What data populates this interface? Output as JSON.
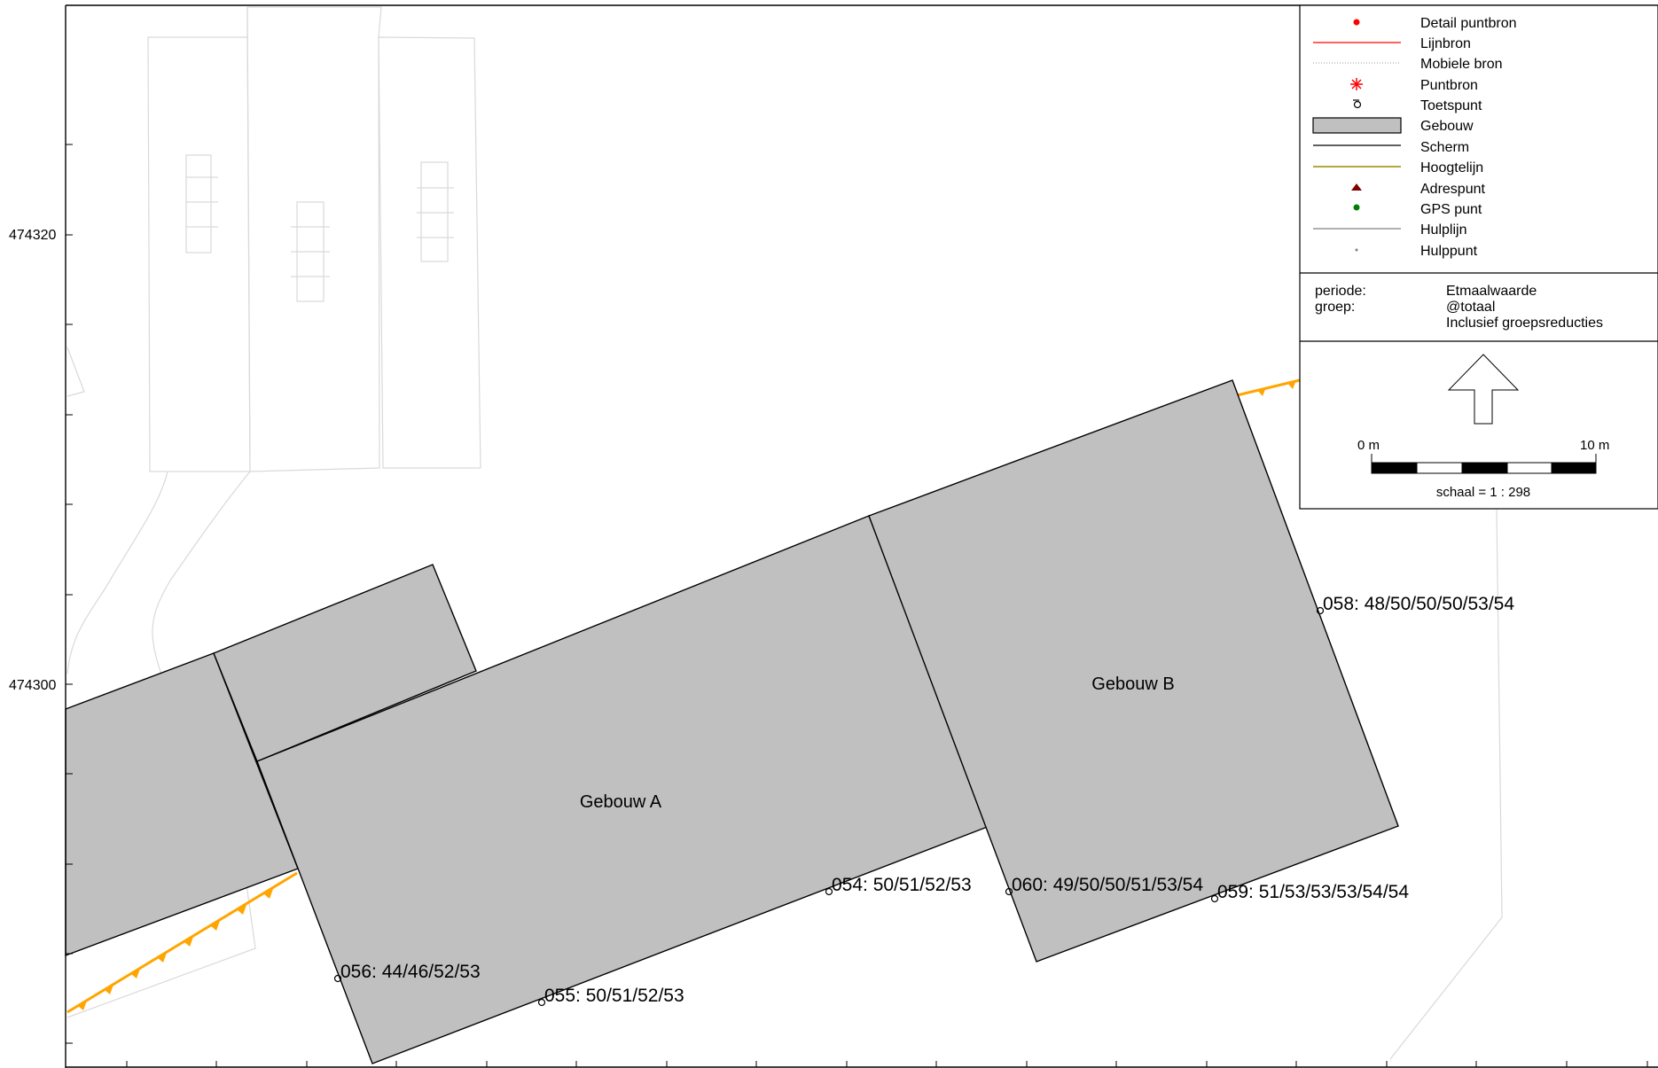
{
  "axis": {
    "y_labels": [
      "474320",
      "474300"
    ]
  },
  "buildings": [
    {
      "id": "gebouw-a",
      "label": "Gebouw A"
    },
    {
      "id": "gebouw-b",
      "label": "Gebouw B"
    }
  ],
  "test_points": [
    {
      "label": "056: 44/46/52/53"
    },
    {
      "label": "055: 50/51/52/53"
    },
    {
      "label": "054: 50/51/52/53"
    },
    {
      "label": "060: 49/50/50/51/53/54"
    },
    {
      "label": "059: 51/53/53/53/54/54"
    },
    {
      "label": "058: 48/50/50/50/53/54"
    }
  ],
  "legend": {
    "items": [
      {
        "label": "Detail puntbron",
        "symbol": "dot-red"
      },
      {
        "label": "Lijnbron",
        "symbol": "line-red"
      },
      {
        "label": "Mobiele bron",
        "symbol": "line-dotted"
      },
      {
        "label": "Puntbron",
        "symbol": "asterisk-red"
      },
      {
        "label": "Toetspunt",
        "symbol": "toetspunt"
      },
      {
        "label": "Gebouw",
        "symbol": "rect-gray"
      },
      {
        "label": "Scherm",
        "symbol": "line-black"
      },
      {
        "label": "Hoogtelijn",
        "symbol": "line-olive"
      },
      {
        "label": "Adrespunt",
        "symbol": "triangle-darkred"
      },
      {
        "label": "GPS punt",
        "symbol": "dot-green"
      },
      {
        "label": "Hulplijn",
        "symbol": "line-gray"
      },
      {
        "label": "Hulppunt",
        "symbol": "dot-gray"
      }
    ],
    "info": {
      "periode_key": "periode:",
      "periode_value": "Etmaalwaarde",
      "groep_key": "groep:",
      "groep_value": "@totaal",
      "groep_extra": "Inclusief groepsreducties"
    },
    "scale": {
      "start": "0 m",
      "end": "10 m",
      "text": "schaal = 1 : 298"
    }
  },
  "colors": {
    "building_fill": "#c0c0c0",
    "screen_line": "#ffa500",
    "background_lines": "#d9d9d9",
    "red": "#ff0000",
    "olive": "#9a8a00",
    "darkred": "#800000",
    "green": "#008000"
  }
}
